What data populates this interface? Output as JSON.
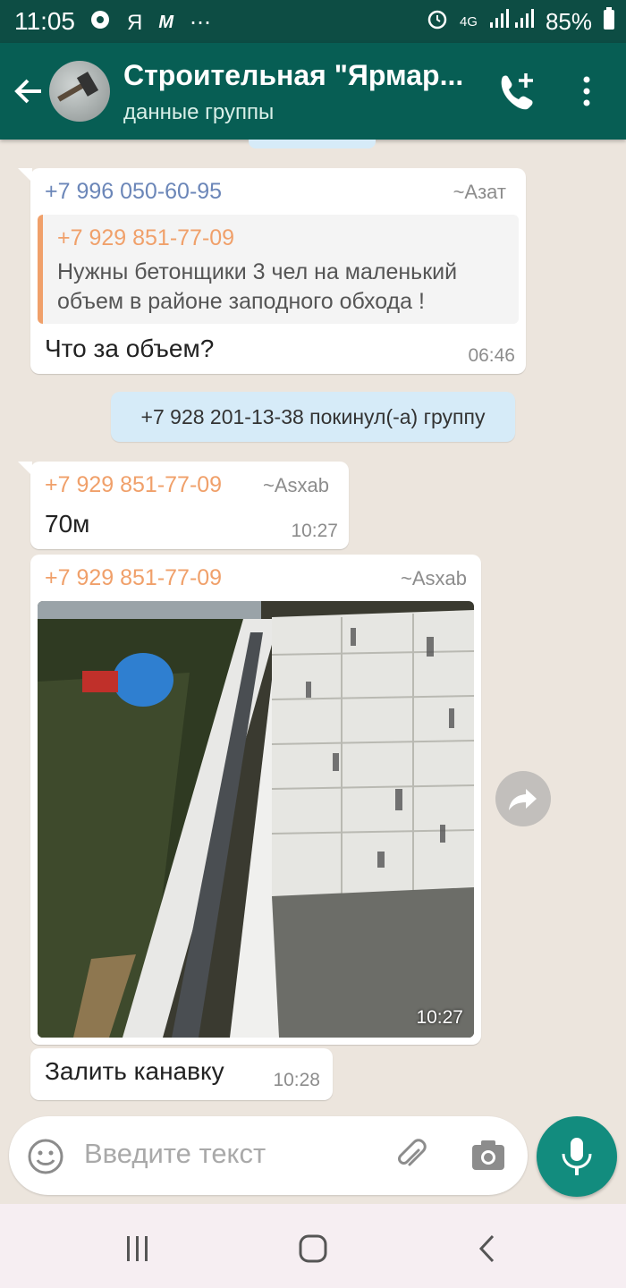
{
  "status_bar": {
    "time": "11:05",
    "carrier": "Я",
    "network": "4G",
    "battery": "85%"
  },
  "header": {
    "title": "Строительная \"Ярмар...",
    "subtitle": "данные группы"
  },
  "messages": [
    {
      "sender": "+7 996 050-60-95",
      "alias": "~Азат",
      "quote": {
        "name": "+7 929 851-77-09",
        "text": "Нужны бетонщики 3 чел на маленький объем в районе заподного обхода !"
      },
      "text": "Что за объем?",
      "time": "06:46"
    },
    {
      "system": "+7 928 201-13-38 покинул(-а) группу"
    },
    {
      "sender": "+7 929 851-77-09",
      "alias": "~Asxab",
      "text": "70м",
      "time": "10:27"
    },
    {
      "sender": "+7 929 851-77-09",
      "alias": "~Asxab",
      "image": "construction-photo",
      "time": "10:27"
    },
    {
      "text": "Залить канавку",
      "time": "10:28"
    }
  ],
  "input": {
    "placeholder": "Введите текст"
  },
  "colors": {
    "header": "#075e54",
    "status_bar": "#0d4d44",
    "sender_blue": "#6b86b8",
    "sender_orange": "#f0a06a",
    "mic": "#128c7e",
    "chat_bg": "#ece5dd"
  },
  "icons": [
    "back-arrow-icon",
    "add-call-icon",
    "more-vert-icon",
    "emoji-icon",
    "attach-icon",
    "camera-icon",
    "mic-icon",
    "forward-icon"
  ]
}
